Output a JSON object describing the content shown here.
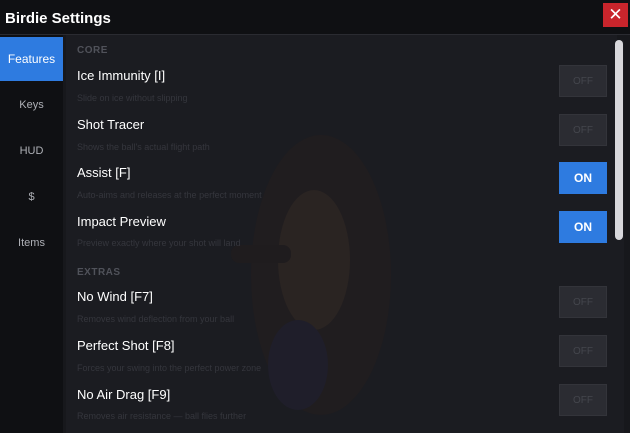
{
  "window": {
    "title": "Birdie Settings",
    "close_label": "✕"
  },
  "sidebar": {
    "items": [
      {
        "label": "Features",
        "active": true
      },
      {
        "label": "Keys",
        "active": false
      },
      {
        "label": "HUD",
        "active": false
      },
      {
        "label": "$",
        "active": false
      },
      {
        "label": "Items",
        "active": false
      }
    ]
  },
  "sections": [
    {
      "heading": "CORE",
      "rows": [
        {
          "title": "Ice Immunity [I]",
          "desc": "Slide on ice without slipping",
          "state": "OFF"
        },
        {
          "title": "Shot Tracer",
          "desc": "Shows the ball's actual flight path",
          "state": "OFF"
        },
        {
          "title": "Assist [F]",
          "desc": "Auto-aims and releases at the perfect moment",
          "state": "ON"
        },
        {
          "title": "Impact Preview",
          "desc": "Preview exactly where your shot will land",
          "state": "ON"
        }
      ]
    },
    {
      "heading": "EXTRAS",
      "rows": [
        {
          "title": "No Wind [F7]",
          "desc": "Removes wind deflection from your ball",
          "state": "OFF"
        },
        {
          "title": "Perfect Shot [F8]",
          "desc": "Forces your swing into the perfect power zone",
          "state": "OFF"
        },
        {
          "title": "No Air Drag [F9]",
          "desc": "Removes air resistance — ball flies further",
          "state": "OFF"
        }
      ]
    }
  ],
  "colors": {
    "accent": "#2e7be0",
    "close": "#c9252c",
    "background": "#1b1c21",
    "sidebar": "#0f1013"
  }
}
